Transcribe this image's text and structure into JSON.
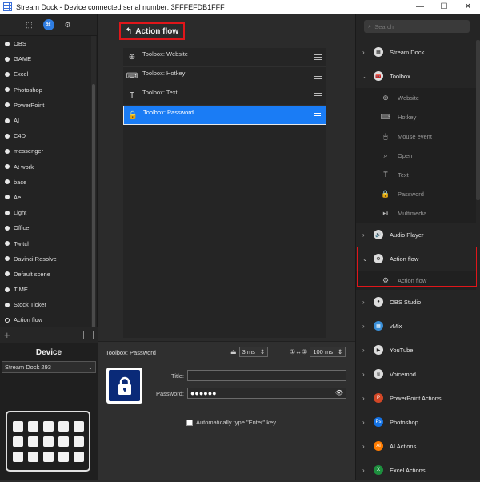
{
  "window": {
    "title": "Stream Dock - Device connected serial number:  3FFFEFDB1FFF",
    "minimize": "—",
    "maximize": "☐",
    "close": "✕"
  },
  "left": {
    "scenes": [
      {
        "label": "OBS",
        "selected": false
      },
      {
        "label": "GAME",
        "selected": false
      },
      {
        "label": "Excel",
        "selected": false
      },
      {
        "label": "Photoshop",
        "selected": false
      },
      {
        "label": "PowerPoint",
        "selected": false
      },
      {
        "label": "AI",
        "selected": false
      },
      {
        "label": "C4D",
        "selected": false
      },
      {
        "label": "messenger",
        "selected": false
      },
      {
        "label": "At work",
        "selected": false
      },
      {
        "label": "bace",
        "selected": false
      },
      {
        "label": "Ae",
        "selected": false
      },
      {
        "label": "Light",
        "selected": false
      },
      {
        "label": "Office",
        "selected": false
      },
      {
        "label": "Twitch",
        "selected": false
      },
      {
        "label": "Davinci Resolve",
        "selected": false
      },
      {
        "label": "Default scene",
        "selected": false
      },
      {
        "label": "TIME",
        "selected": false
      },
      {
        "label": "Stock Ticker",
        "selected": false
      },
      {
        "label": "Action flow",
        "selected": true
      }
    ],
    "add_label": "+",
    "device_title": "Device",
    "device_selected": "Stream Dock 293",
    "device_keys": 15
  },
  "center": {
    "header": "Action flow",
    "actions": [
      {
        "label": "Toolbox: Website",
        "icon": "globe-icon",
        "glyph": "⊕",
        "selected": false
      },
      {
        "label": "Toolbox: Hotkey",
        "icon": "keyboard-icon",
        "glyph": "⌨",
        "selected": false
      },
      {
        "label": "Toolbox: Text",
        "icon": "text-icon",
        "glyph": "T",
        "selected": false
      },
      {
        "label": "Toolbox: Password",
        "icon": "lock-icon",
        "glyph": "🔒",
        "selected": true
      }
    ],
    "props": {
      "title": "Toolbox: Password",
      "delay_value": "3 ms",
      "interval_value": "100 ms",
      "title_label": "Title:",
      "title_value": "",
      "password_label": "Password:",
      "password_value": "●●●●●●",
      "auto_enter_label": "Automatically type \"Enter\" key"
    }
  },
  "right": {
    "search_placeholder": "Search",
    "categories": [
      {
        "label": "Stream Dock",
        "expanded": false,
        "icon": "stream-dock-icon",
        "glyph": "▦",
        "color": "#dddddd"
      },
      {
        "label": "Toolbox",
        "expanded": true,
        "icon": "toolbox-icon",
        "glyph": "🧰",
        "color": "#dddddd",
        "items": [
          {
            "label": "Website",
            "icon": "globe-icon",
            "glyph": "⊕"
          },
          {
            "label": "Hotkey",
            "icon": "keyboard-icon",
            "glyph": "⌨"
          },
          {
            "label": "Mouse event",
            "icon": "mouse-icon",
            "glyph": "🖱"
          },
          {
            "label": "Open",
            "icon": "open-icon",
            "glyph": "⌕"
          },
          {
            "label": "Text",
            "icon": "text-icon",
            "glyph": "T"
          },
          {
            "label": "Password",
            "icon": "lock-icon",
            "glyph": "🔒"
          },
          {
            "label": "Multimedia",
            "icon": "play-pause-icon",
            "glyph": "⏯"
          }
        ]
      },
      {
        "label": "Audio Player",
        "expanded": false,
        "icon": "speaker-icon",
        "glyph": "🔊",
        "color": "#dddddd"
      },
      {
        "label": "Action flow",
        "expanded": true,
        "icon": "action-flow-icon",
        "glyph": "⚙",
        "color": "#dddddd",
        "items": [
          {
            "label": "Action flow",
            "icon": "action-flow-icon",
            "glyph": "⚙"
          }
        ]
      },
      {
        "label": "OBS Studio",
        "expanded": false,
        "icon": "obs-icon",
        "glyph": "●",
        "color": "#dddddd"
      },
      {
        "label": "vMix",
        "expanded": false,
        "icon": "vmix-icon",
        "glyph": "▦",
        "color": "#3a8fd8"
      },
      {
        "label": "YouTube",
        "expanded": false,
        "icon": "youtube-icon",
        "glyph": "▶",
        "color": "#dddddd"
      },
      {
        "label": "Voicemod",
        "expanded": false,
        "icon": "voicemod-icon",
        "glyph": "≋",
        "color": "#dddddd"
      },
      {
        "label": "PowerPoint Actions",
        "expanded": false,
        "icon": "powerpoint-icon",
        "glyph": "P",
        "color": "#d24726"
      },
      {
        "label": "Photoshop",
        "expanded": false,
        "icon": "photoshop-icon",
        "glyph": "Ps",
        "color": "#1473e6"
      },
      {
        "label": "AI Actions",
        "expanded": false,
        "icon": "illustrator-icon",
        "glyph": "Ai",
        "color": "#ff7c00"
      },
      {
        "label": "Excel Actions",
        "expanded": false,
        "icon": "excel-icon",
        "glyph": "X",
        "color": "#1d8f3e"
      }
    ]
  }
}
